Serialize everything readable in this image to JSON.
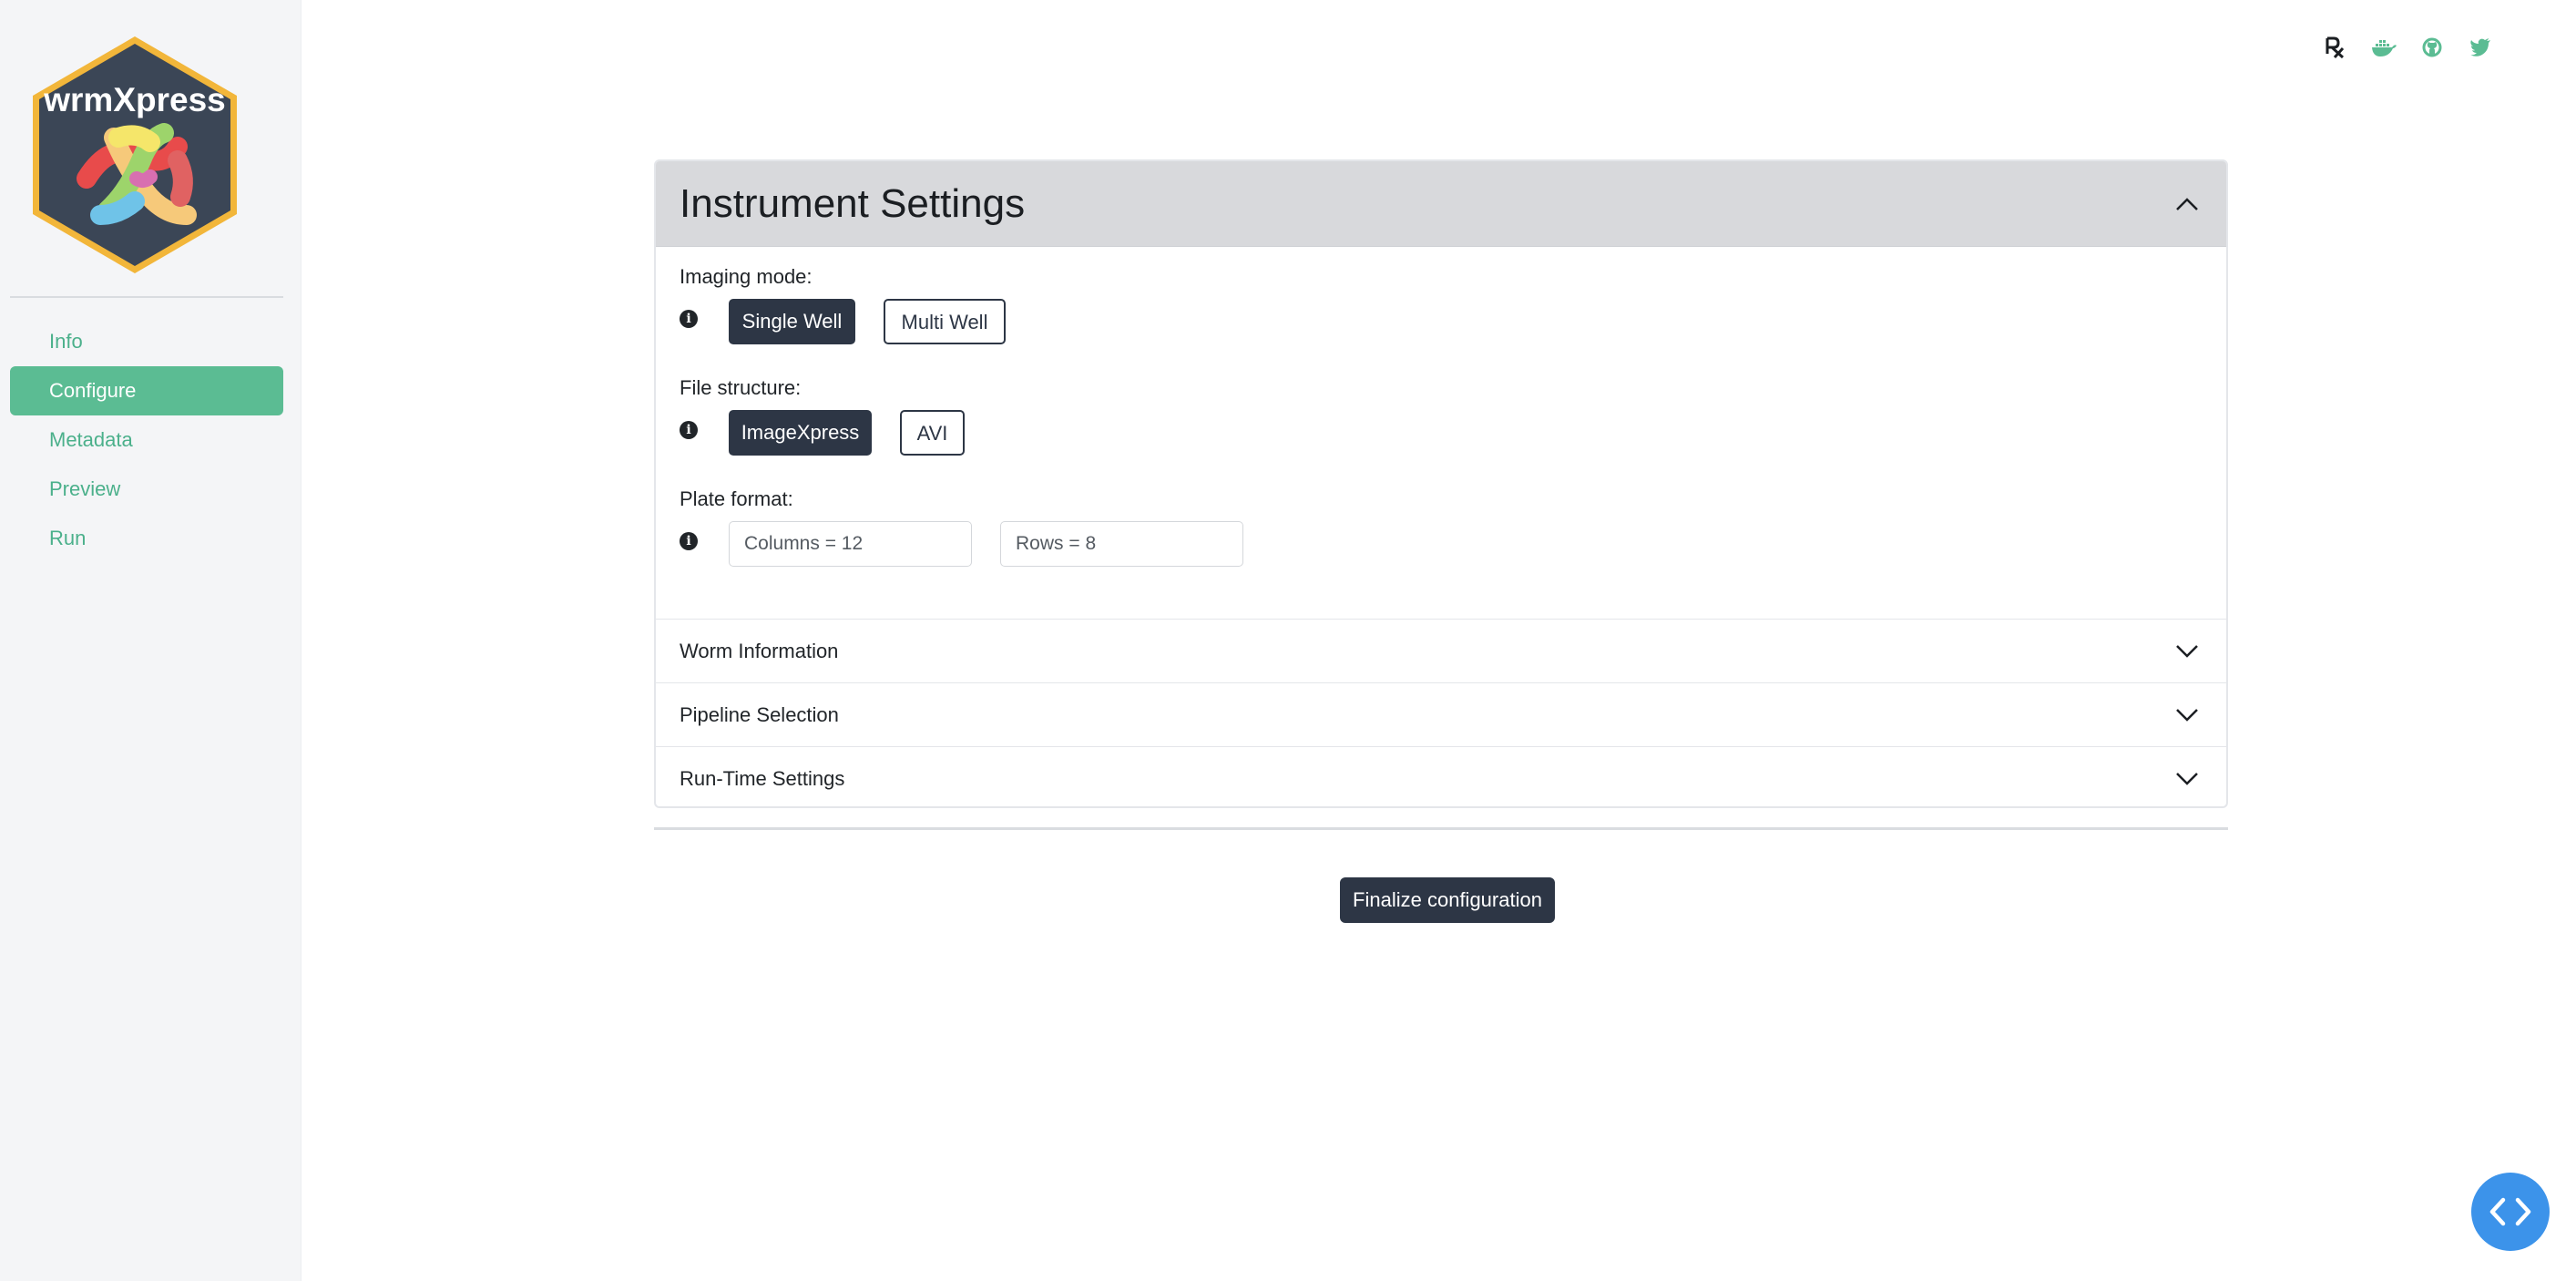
{
  "app": {
    "logo_text": "wrmXpress"
  },
  "sidebar": {
    "items": [
      {
        "label": "Info"
      },
      {
        "label": "Configure"
      },
      {
        "label": "Metadata"
      },
      {
        "label": "Preview"
      },
      {
        "label": "Run"
      }
    ],
    "active_index": 1
  },
  "top_icons": [
    "rx-icon",
    "docker-icon",
    "github-icon",
    "twitter-icon"
  ],
  "card": {
    "title": "Instrument Settings",
    "imaging_mode": {
      "label": "Imaging mode:",
      "options": [
        "Single Well",
        "Multi Well"
      ],
      "selected": "Single Well"
    },
    "file_structure": {
      "label": "File structure:",
      "options": [
        "ImageXpress",
        "AVI"
      ],
      "selected": "ImageXpress"
    },
    "plate_format": {
      "label": "Plate format:",
      "columns_placeholder": "Columns = 12",
      "rows_placeholder": "Rows = 8"
    },
    "accordion_items": [
      {
        "label": "Worm Information"
      },
      {
        "label": "Pipeline Selection"
      },
      {
        "label": "Run-Time Settings"
      }
    ]
  },
  "finalize_label": "Finalize configuration",
  "colors": {
    "accent": "#5bbc93",
    "dark": "#2d3645",
    "fab": "#3c93ea"
  }
}
